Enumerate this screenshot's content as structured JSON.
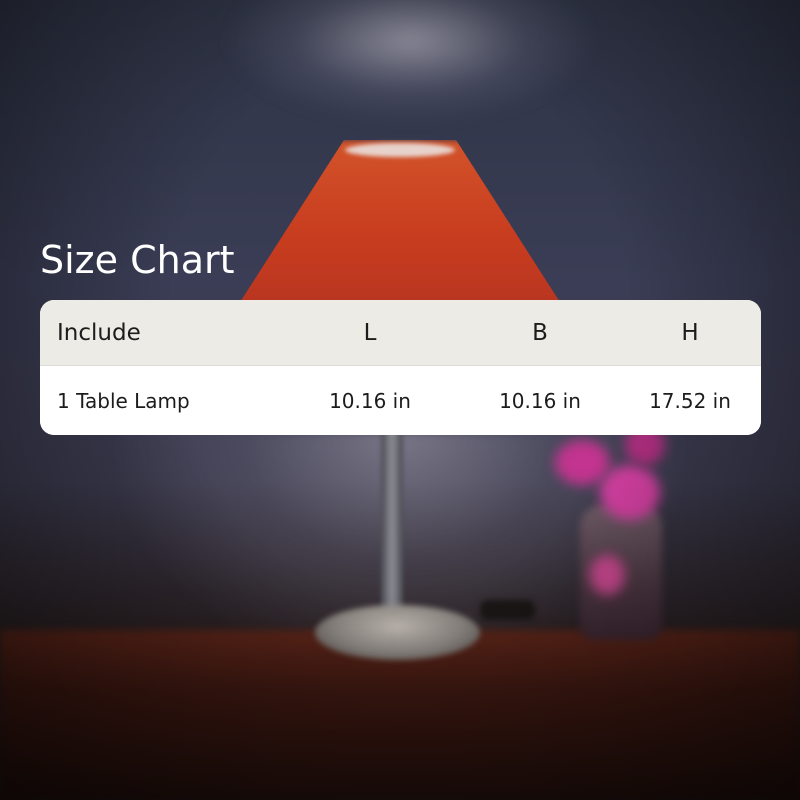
{
  "title": "Size Chart",
  "table": {
    "headers": [
      "Include",
      "L",
      "B",
      "H"
    ],
    "rows": [
      [
        "1 Table Lamp",
        "10.16 in",
        "10.16 in",
        "17.52 in"
      ]
    ]
  },
  "colors": {
    "header_bg": "#ecebe6",
    "row_bg": "#ffffff",
    "text": "#1c1c1c",
    "title": "#ffffff",
    "lamp_shade": "#c8401f"
  }
}
